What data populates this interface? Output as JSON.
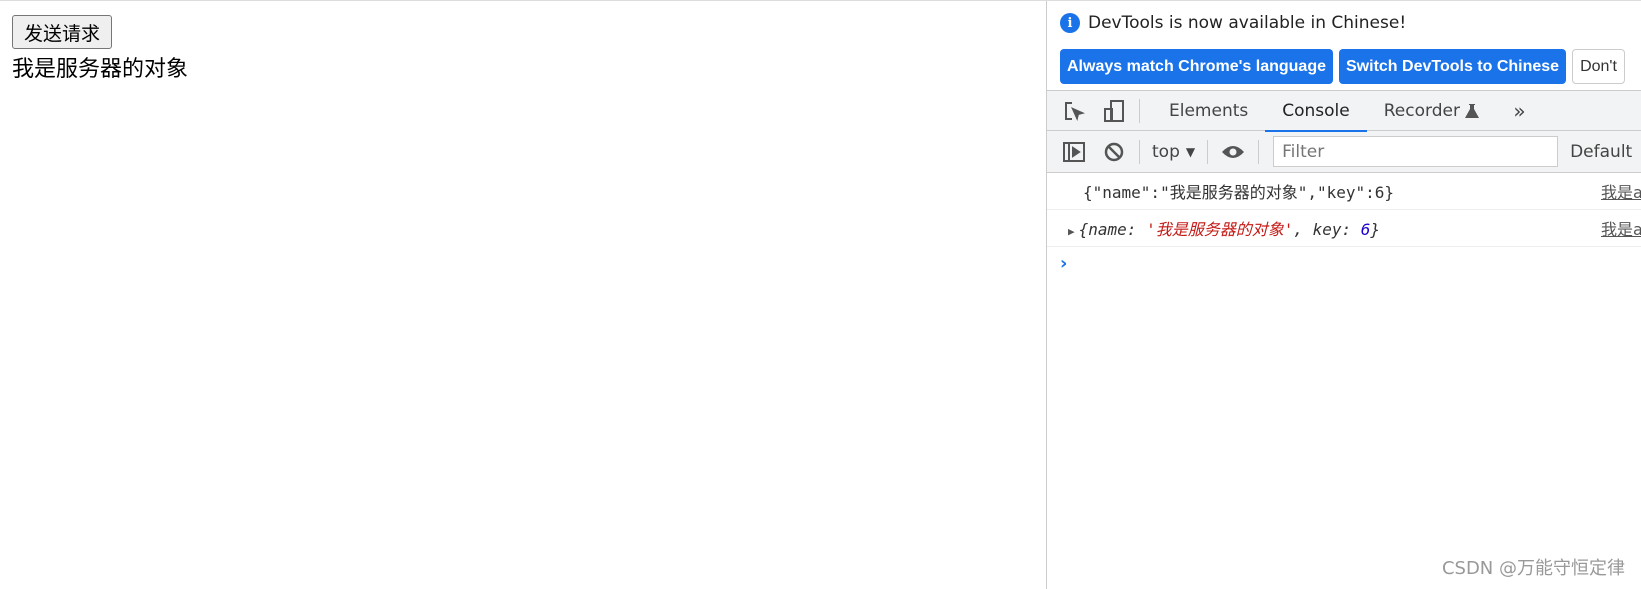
{
  "page": {
    "button_label": "发送请求",
    "result_text": "我是服务器的对象"
  },
  "devtools": {
    "info_message": "DevTools is now available in Chinese!",
    "info_buttons": [
      "Always match Chrome's language",
      "Switch DevTools to Chinese",
      "Don't"
    ],
    "tabs": [
      "Elements",
      "Console",
      "Recorder"
    ],
    "active_tab": "Console",
    "more_tabs": "»",
    "context": "top",
    "filter_placeholder": "Filter",
    "levels": "Default",
    "logs": [
      {
        "text": "{\"name\":\"我是服务器的对象\",\"key\":6}",
        "source": "我是ajax"
      },
      {
        "prefix": "{name: ",
        "string": "'我是服务器的对象'",
        "mid": ", key: ",
        "number": "6",
        "suffix": "}",
        "source": "我是ajax"
      }
    ],
    "prompt": "›"
  },
  "watermark": "CSDN @万能守恒定律",
  "colors": {
    "accent": "#1a73e8",
    "string": "#c41a16",
    "number": "#1c00cf"
  }
}
